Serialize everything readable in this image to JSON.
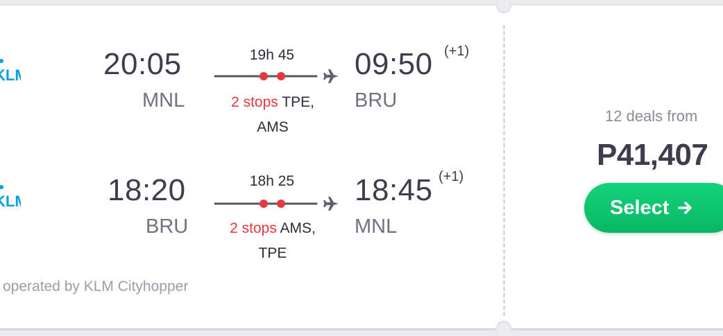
{
  "flights": [
    {
      "airline_logo": "KLM",
      "departure_time": "20:05",
      "departure_airport": "MNL",
      "duration": "19h 45",
      "stops_count": "2 stops",
      "stops_via": "TPE,",
      "stops_via_line2": "AMS",
      "arrival_time": "09:50",
      "day_offset": "(+1)",
      "arrival_airport": "BRU"
    },
    {
      "airline_logo": "KLM",
      "departure_time": "18:20",
      "departure_airport": "BRU",
      "duration": "18h 25",
      "stops_count": "2 stops",
      "stops_via": "AMS,",
      "stops_via_line2": "TPE",
      "arrival_time": "18:45",
      "day_offset": "(+1)",
      "arrival_airport": "MNL"
    }
  ],
  "operated_by": "operated by KLM Cityhopper",
  "deals_label": "12 deals from",
  "price": "P41,407",
  "select_label": "Select",
  "icons": {
    "route_end": "airplane-icon",
    "select_arrow": "arrow-right-icon"
  },
  "colors": {
    "stop_dot": "#e4393f",
    "stops_text": "#e4393f",
    "select_button": "#0fc873",
    "klm_blue": "#00a1de"
  }
}
